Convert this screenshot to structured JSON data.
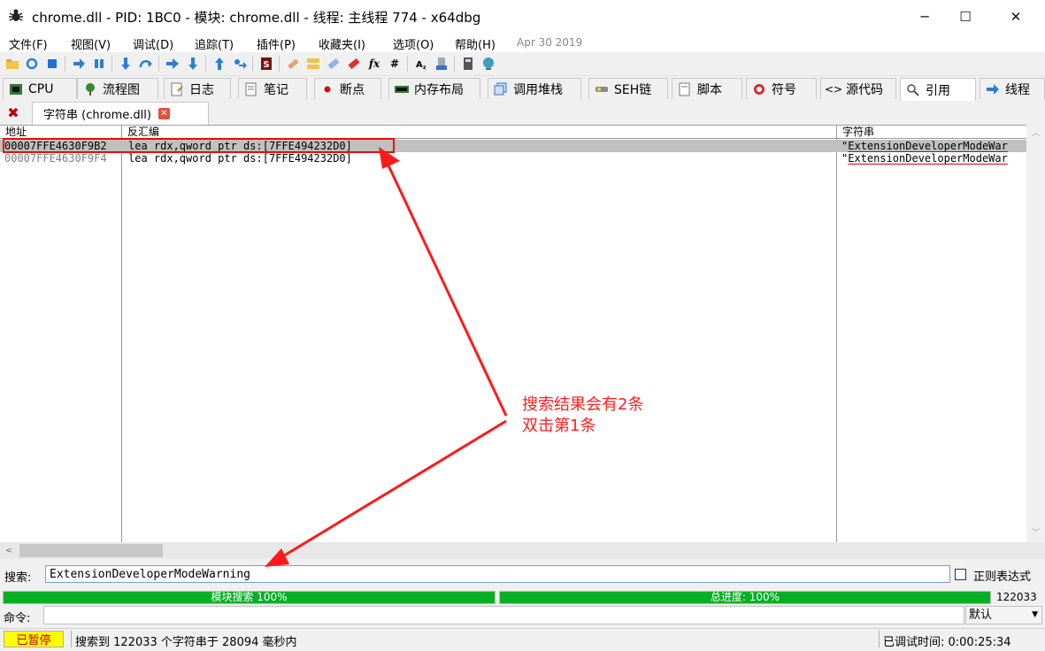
{
  "window": {
    "title": "chrome.dll - PID: 1BC0 - 模块: chrome.dll - 线程: 主线程 774 - x64dbg",
    "minimize": "─",
    "maximize": "☐",
    "close": "✕"
  },
  "menu": {
    "items": [
      "文件(F)",
      "视图(V)",
      "调试(D)",
      "追踪(T)",
      "插件(P)",
      "收藏夹(I)",
      "选项(O)",
      "帮助(H)"
    ],
    "build_date": "Apr 30 2019"
  },
  "toolbar": {
    "icons": [
      "open-icon",
      "restart-icon",
      "stop-icon",
      "run-icon",
      "pause-icon",
      "step-into-icon",
      "step-over-icon",
      "trace-into-icon",
      "trace-over-icon",
      "execute-till-return-icon",
      "run-to-user-code-icon",
      "scylla-icon",
      "patch-icon",
      "comment-icon",
      "label-icon",
      "bookmark-icon",
      "function-icon",
      "hash-icon",
      "font-icon",
      "settings-icon",
      "calculator-icon",
      "globe-icon"
    ],
    "fx_label": "fx",
    "hash_label": "#"
  },
  "tabs": [
    {
      "label": "CPU",
      "icon": "cpu-icon"
    },
    {
      "label": "流程图",
      "icon": "graph-icon"
    },
    {
      "label": "日志",
      "icon": "log-icon"
    },
    {
      "label": "笔记",
      "icon": "notes-icon"
    },
    {
      "label": "断点",
      "icon": "breakpoint-icon"
    },
    {
      "label": "内存布局",
      "icon": "memory-map-icon"
    },
    {
      "label": "调用堆栈",
      "icon": "call-stack-icon"
    },
    {
      "label": "SEH链",
      "icon": "seh-icon"
    },
    {
      "label": "脚本",
      "icon": "script-icon"
    },
    {
      "label": "符号",
      "icon": "symbols-icon"
    },
    {
      "label": "源代码",
      "icon": "source-icon"
    },
    {
      "label": "引用",
      "icon": "references-icon"
    },
    {
      "label": "线程",
      "icon": "threads-icon"
    }
  ],
  "subtab": {
    "label": "字符串 (chrome.dll)"
  },
  "table": {
    "headers": [
      "地址",
      "反汇编",
      "字符串"
    ],
    "rows": [
      {
        "address": "00007FFE4630F9B2",
        "disasm": "lea rdx,qword ptr ds:[7FFE494232D0]",
        "quote": "\"",
        "string": "ExtensionDeveloperModeWar"
      },
      {
        "address": "00007FFE4630F9F4",
        "disasm": "lea rdx,qword ptr ds:[7FFE494232D0]",
        "quote": "\"",
        "string": "ExtensionDeveloperModeWar"
      }
    ]
  },
  "search": {
    "label": "搜索:",
    "value": "ExtensionDeveloperModeWarning",
    "regex_label": "正则表达式",
    "regex_checked": false
  },
  "progress": {
    "module_label": "模块搜索 100%",
    "module_fraction": 1.0,
    "total_label": "总进度: 100%",
    "total_fraction": 1.0,
    "count": "122033"
  },
  "command": {
    "label": "命令:",
    "value": "",
    "mode": "默认"
  },
  "status": {
    "state": "已暂停",
    "message": "搜索到 122033 个字符串于 28094 毫秒内",
    "debug_time": "已调试时间:  0:00:25:34"
  },
  "annotation": {
    "lines": [
      "搜索结果会有2条",
      "双击第1条"
    ]
  },
  "colors": {
    "progress_green": "#06b025",
    "selected_row": "#c0c0c0",
    "annotation_red": "#ff0000",
    "paused_badge": "#ffff00"
  }
}
